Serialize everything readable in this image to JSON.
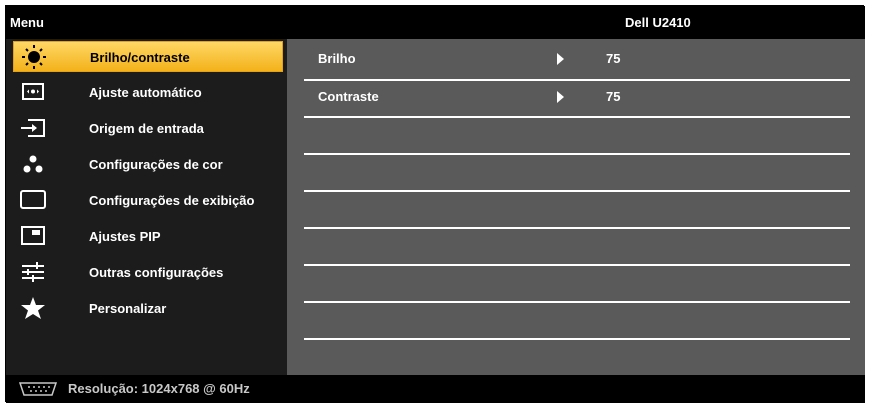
{
  "header": {
    "menu_label": "Menu",
    "model": "Dell U2410"
  },
  "sidebar": {
    "items": [
      {
        "label": "Brilho/contraste",
        "icon": "sun-icon",
        "selected": true
      },
      {
        "label": "Ajuste automático",
        "icon": "auto-adjust-icon"
      },
      {
        "label": "Origem de entrada",
        "icon": "input-source-icon"
      },
      {
        "label": "Configurações de cor",
        "icon": "color-dots-icon"
      },
      {
        "label": "Configurações de exibição",
        "icon": "display-rectangle-icon"
      },
      {
        "label": "Ajustes PIP",
        "icon": "pip-icon"
      },
      {
        "label": "Outras configurações",
        "icon": "sliders-icon"
      },
      {
        "label": "Personalizar",
        "icon": "star-icon"
      }
    ]
  },
  "panel": {
    "rows": [
      {
        "name": "Brilho",
        "value": "75"
      },
      {
        "name": "Contraste",
        "value": "75"
      }
    ]
  },
  "status": {
    "icon": "vga-connector-icon",
    "text": "Resolução: 1024x768 @ 60Hz"
  },
  "colors": {
    "selected_bg": "#f3b21a",
    "panel_bg": "#5a5a5a",
    "sidebar_bg": "#1c1c1c"
  }
}
